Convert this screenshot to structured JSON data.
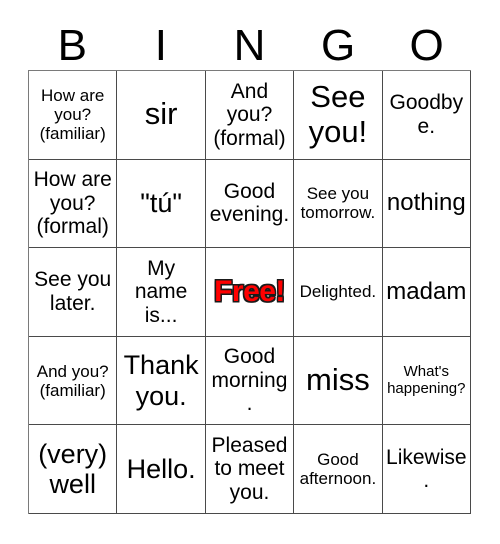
{
  "card": {
    "title": "BINGO",
    "free_space_label": "Free!",
    "free_space_color": "#ff0000",
    "free_space_outline_color": "#1a1a1a",
    "border_color": "#4a4a4a",
    "background_color": "#ffffff",
    "text_color": "#000000",
    "columns": 5,
    "rows": 5
  },
  "header": {
    "letters": [
      {
        "label": "B"
      },
      {
        "label": "I"
      },
      {
        "label": "N"
      },
      {
        "label": "G"
      },
      {
        "label": "O"
      }
    ]
  },
  "grid": {
    "rows": [
      {
        "cells": [
          {
            "text": "How are you? (familiar)",
            "size": "sm",
            "free": false
          },
          {
            "text": "sir",
            "size": "xxl",
            "free": false
          },
          {
            "text": "And you? (formal)",
            "size": "md",
            "free": false
          },
          {
            "text": "See you!",
            "size": "xxl",
            "free": false
          },
          {
            "text": "Goodbye.",
            "size": "md",
            "free": false
          }
        ]
      },
      {
        "cells": [
          {
            "text": "How are you? (formal)",
            "size": "md",
            "free": false
          },
          {
            "text": "\"tú\"",
            "size": "xl",
            "free": false
          },
          {
            "text": "Good evening.",
            "size": "md",
            "free": false
          },
          {
            "text": "See you tomorrow.",
            "size": "sm",
            "free": false
          },
          {
            "text": "nothing",
            "size": "lg",
            "free": false
          }
        ]
      },
      {
        "cells": [
          {
            "text": "See you later.",
            "size": "md",
            "free": false
          },
          {
            "text": "My name is...",
            "size": "md",
            "free": false
          },
          {
            "text": "Free!",
            "size": "xl",
            "free": true
          },
          {
            "text": "Delighted.",
            "size": "sm",
            "free": false
          },
          {
            "text": "madam",
            "size": "lg",
            "free": false
          }
        ]
      },
      {
        "cells": [
          {
            "text": "And you? (familiar)",
            "size": "sm",
            "free": false
          },
          {
            "text": "Thank you.",
            "size": "xl",
            "free": false
          },
          {
            "text": "Good morning.",
            "size": "md",
            "free": false
          },
          {
            "text": "miss",
            "size": "xxl",
            "free": false
          },
          {
            "text": "What's happening?",
            "size": "xs",
            "free": false
          }
        ]
      },
      {
        "cells": [
          {
            "text": "(very) well",
            "size": "xl",
            "free": false
          },
          {
            "text": "Hello.",
            "size": "xl",
            "free": false
          },
          {
            "text": "Pleased to meet you.",
            "size": "md",
            "free": false
          },
          {
            "text": "Good afternoon.",
            "size": "sm",
            "free": false
          },
          {
            "text": "Likewise.",
            "size": "md",
            "free": false
          }
        ]
      }
    ]
  }
}
